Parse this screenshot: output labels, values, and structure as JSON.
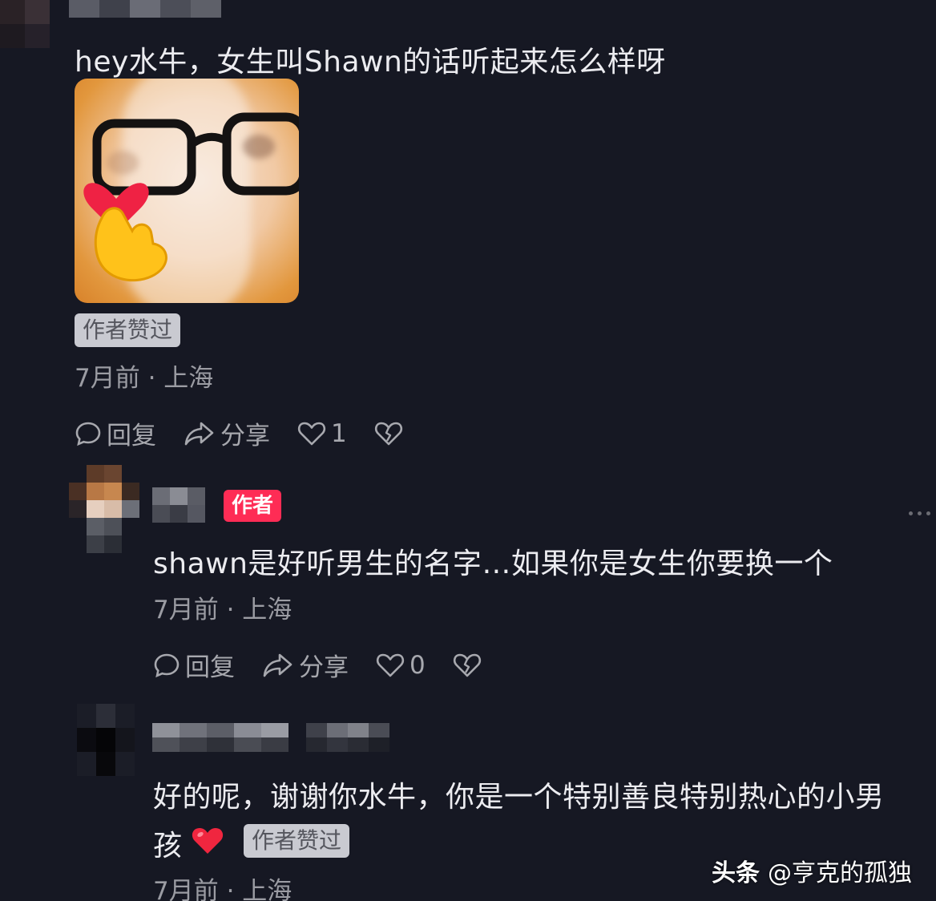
{
  "comments": [
    {
      "text": "hey水牛，女生叫Shawn的话听起来怎么样呀",
      "liked_badge": "作者赞过",
      "meta": "7月前 · 上海",
      "actions": {
        "reply": "回复",
        "share": "分享",
        "like_count": "1"
      }
    },
    {
      "author_badge": "作者",
      "text": "shawn是好听男生的名字…如果你是女生你要换一个",
      "meta": "7月前 · 上海",
      "actions": {
        "reply": "回复",
        "share": "分享",
        "like_count": "0"
      }
    },
    {
      "text_line1": "好的呢，谢谢你水牛，你是一个特别善良特别热心的小男",
      "text_line2": "孩",
      "liked_badge": "作者赞过",
      "meta": "7月前 · 上海"
    }
  ],
  "watermark": {
    "brand": "头条",
    "handle": "@亨克的孤独"
  },
  "icons": {
    "reply": "comment-bubble-icon",
    "share": "share-arrow-icon",
    "like": "heart-outline-icon",
    "dislike": "broken-heart-icon",
    "more": "more-dots-icon",
    "heart_emoji": "red-heart-icon"
  },
  "colors": {
    "background": "#161823",
    "author_badge": "#fe2c55",
    "liked_badge": "#c9cad1"
  }
}
